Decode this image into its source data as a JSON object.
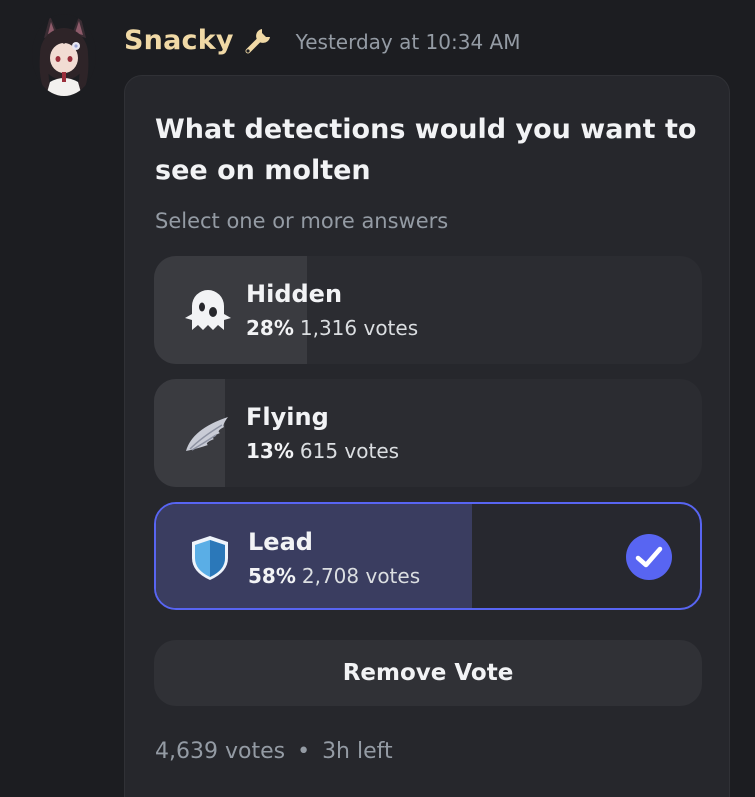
{
  "message": {
    "author": "Snacky",
    "author_color": "#f0d9a6",
    "role_icon": "wrench-icon",
    "timestamp": "Yesterday at 10:34 AM"
  },
  "poll": {
    "question": "What detections would you want to see on molten",
    "subtitle": "Select one or more answers",
    "answers": [
      {
        "label": "Hidden",
        "icon": "ghost-icon",
        "percent_label": "28%",
        "percent": 28,
        "votes": "1,316 votes",
        "selected": false
      },
      {
        "label": "Flying",
        "icon": "wing-icon",
        "percent_label": "13%",
        "percent": 13,
        "votes": "615 votes",
        "selected": false
      },
      {
        "label": "Lead",
        "icon": "shield-icon",
        "percent_label": "58%",
        "percent": 58,
        "votes": "2,708 votes",
        "selected": true
      }
    ],
    "remove_vote_label": "Remove Vote",
    "total_votes": "4,639 votes",
    "separator": "•",
    "time_left": "3h left",
    "accent_color": "#5865f2"
  }
}
